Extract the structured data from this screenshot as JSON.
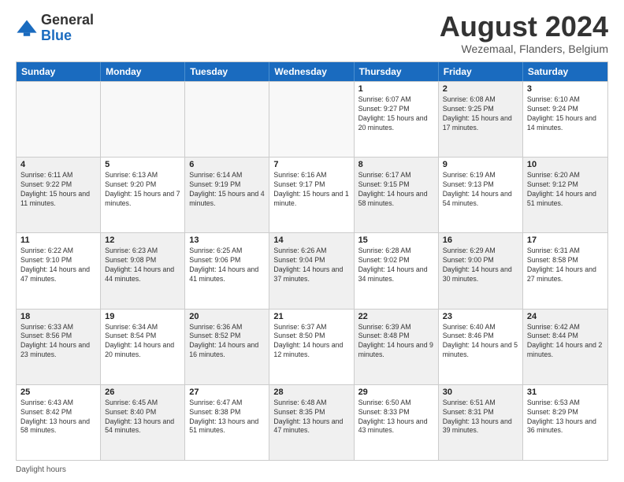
{
  "header": {
    "logo_general": "General",
    "logo_blue": "Blue",
    "month_title": "August 2024",
    "location": "Wezemaal, Flanders, Belgium"
  },
  "days_of_week": [
    "Sunday",
    "Monday",
    "Tuesday",
    "Wednesday",
    "Thursday",
    "Friday",
    "Saturday"
  ],
  "weeks": [
    [
      {
        "day": "",
        "info": "",
        "shaded": false,
        "empty": true
      },
      {
        "day": "",
        "info": "",
        "shaded": false,
        "empty": true
      },
      {
        "day": "",
        "info": "",
        "shaded": false,
        "empty": true
      },
      {
        "day": "",
        "info": "",
        "shaded": false,
        "empty": true
      },
      {
        "day": "1",
        "info": "Sunrise: 6:07 AM\nSunset: 9:27 PM\nDaylight: 15 hours and 20 minutes.",
        "shaded": false,
        "empty": false
      },
      {
        "day": "2",
        "info": "Sunrise: 6:08 AM\nSunset: 9:25 PM\nDaylight: 15 hours and 17 minutes.",
        "shaded": true,
        "empty": false
      },
      {
        "day": "3",
        "info": "Sunrise: 6:10 AM\nSunset: 9:24 PM\nDaylight: 15 hours and 14 minutes.",
        "shaded": false,
        "empty": false
      }
    ],
    [
      {
        "day": "4",
        "info": "Sunrise: 6:11 AM\nSunset: 9:22 PM\nDaylight: 15 hours and 11 minutes.",
        "shaded": true,
        "empty": false
      },
      {
        "day": "5",
        "info": "Sunrise: 6:13 AM\nSunset: 9:20 PM\nDaylight: 15 hours and 7 minutes.",
        "shaded": false,
        "empty": false
      },
      {
        "day": "6",
        "info": "Sunrise: 6:14 AM\nSunset: 9:19 PM\nDaylight: 15 hours and 4 minutes.",
        "shaded": true,
        "empty": false
      },
      {
        "day": "7",
        "info": "Sunrise: 6:16 AM\nSunset: 9:17 PM\nDaylight: 15 hours and 1 minute.",
        "shaded": false,
        "empty": false
      },
      {
        "day": "8",
        "info": "Sunrise: 6:17 AM\nSunset: 9:15 PM\nDaylight: 14 hours and 58 minutes.",
        "shaded": true,
        "empty": false
      },
      {
        "day": "9",
        "info": "Sunrise: 6:19 AM\nSunset: 9:13 PM\nDaylight: 14 hours and 54 minutes.",
        "shaded": false,
        "empty": false
      },
      {
        "day": "10",
        "info": "Sunrise: 6:20 AM\nSunset: 9:12 PM\nDaylight: 14 hours and 51 minutes.",
        "shaded": true,
        "empty": false
      }
    ],
    [
      {
        "day": "11",
        "info": "Sunrise: 6:22 AM\nSunset: 9:10 PM\nDaylight: 14 hours and 47 minutes.",
        "shaded": false,
        "empty": false
      },
      {
        "day": "12",
        "info": "Sunrise: 6:23 AM\nSunset: 9:08 PM\nDaylight: 14 hours and 44 minutes.",
        "shaded": true,
        "empty": false
      },
      {
        "day": "13",
        "info": "Sunrise: 6:25 AM\nSunset: 9:06 PM\nDaylight: 14 hours and 41 minutes.",
        "shaded": false,
        "empty": false
      },
      {
        "day": "14",
        "info": "Sunrise: 6:26 AM\nSunset: 9:04 PM\nDaylight: 14 hours and 37 minutes.",
        "shaded": true,
        "empty": false
      },
      {
        "day": "15",
        "info": "Sunrise: 6:28 AM\nSunset: 9:02 PM\nDaylight: 14 hours and 34 minutes.",
        "shaded": false,
        "empty": false
      },
      {
        "day": "16",
        "info": "Sunrise: 6:29 AM\nSunset: 9:00 PM\nDaylight: 14 hours and 30 minutes.",
        "shaded": true,
        "empty": false
      },
      {
        "day": "17",
        "info": "Sunrise: 6:31 AM\nSunset: 8:58 PM\nDaylight: 14 hours and 27 minutes.",
        "shaded": false,
        "empty": false
      }
    ],
    [
      {
        "day": "18",
        "info": "Sunrise: 6:33 AM\nSunset: 8:56 PM\nDaylight: 14 hours and 23 minutes.",
        "shaded": true,
        "empty": false
      },
      {
        "day": "19",
        "info": "Sunrise: 6:34 AM\nSunset: 8:54 PM\nDaylight: 14 hours and 20 minutes.",
        "shaded": false,
        "empty": false
      },
      {
        "day": "20",
        "info": "Sunrise: 6:36 AM\nSunset: 8:52 PM\nDaylight: 14 hours and 16 minutes.",
        "shaded": true,
        "empty": false
      },
      {
        "day": "21",
        "info": "Sunrise: 6:37 AM\nSunset: 8:50 PM\nDaylight: 14 hours and 12 minutes.",
        "shaded": false,
        "empty": false
      },
      {
        "day": "22",
        "info": "Sunrise: 6:39 AM\nSunset: 8:48 PM\nDaylight: 14 hours and 9 minutes.",
        "shaded": true,
        "empty": false
      },
      {
        "day": "23",
        "info": "Sunrise: 6:40 AM\nSunset: 8:46 PM\nDaylight: 14 hours and 5 minutes.",
        "shaded": false,
        "empty": false
      },
      {
        "day": "24",
        "info": "Sunrise: 6:42 AM\nSunset: 8:44 PM\nDaylight: 14 hours and 2 minutes.",
        "shaded": true,
        "empty": false
      }
    ],
    [
      {
        "day": "25",
        "info": "Sunrise: 6:43 AM\nSunset: 8:42 PM\nDaylight: 13 hours and 58 minutes.",
        "shaded": false,
        "empty": false
      },
      {
        "day": "26",
        "info": "Sunrise: 6:45 AM\nSunset: 8:40 PM\nDaylight: 13 hours and 54 minutes.",
        "shaded": true,
        "empty": false
      },
      {
        "day": "27",
        "info": "Sunrise: 6:47 AM\nSunset: 8:38 PM\nDaylight: 13 hours and 51 minutes.",
        "shaded": false,
        "empty": false
      },
      {
        "day": "28",
        "info": "Sunrise: 6:48 AM\nSunset: 8:35 PM\nDaylight: 13 hours and 47 minutes.",
        "shaded": true,
        "empty": false
      },
      {
        "day": "29",
        "info": "Sunrise: 6:50 AM\nSunset: 8:33 PM\nDaylight: 13 hours and 43 minutes.",
        "shaded": false,
        "empty": false
      },
      {
        "day": "30",
        "info": "Sunrise: 6:51 AM\nSunset: 8:31 PM\nDaylight: 13 hours and 39 minutes.",
        "shaded": true,
        "empty": false
      },
      {
        "day": "31",
        "info": "Sunrise: 6:53 AM\nSunset: 8:29 PM\nDaylight: 13 hours and 36 minutes.",
        "shaded": false,
        "empty": false
      }
    ]
  ],
  "footer": {
    "daylight_label": "Daylight hours"
  }
}
